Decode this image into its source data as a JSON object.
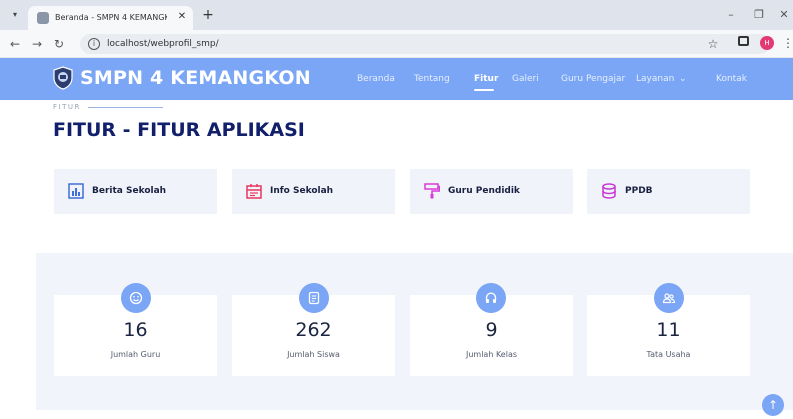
{
  "browser": {
    "tab_title": "Beranda - SMPN 4 KEMANGKO",
    "tab_close": "✕",
    "new_tab": "+",
    "url": "localhost/webprofil_smp/",
    "profile_initial": "H",
    "icons": [
      "tab-menu-icon",
      "favicon-icon",
      "back-icon",
      "forward-icon",
      "reload-icon",
      "info-icon",
      "star-icon",
      "side-panel-icon",
      "profile-icon",
      "kebab-icon",
      "minimize-icon",
      "restore-icon",
      "close-icon"
    ]
  },
  "navbar": {
    "brand": "SMPN 4 KEMANGKON",
    "items": [
      {
        "label": "Beranda",
        "active": false
      },
      {
        "label": "Tentang",
        "active": false
      },
      {
        "label": "Fitur",
        "active": true
      },
      {
        "label": "Galeri",
        "active": false
      },
      {
        "label": "Guru Pengajar",
        "active": false
      },
      {
        "label": "Layanan",
        "active": false
      },
      {
        "label": "Kontak",
        "active": false
      }
    ],
    "dropdown_caret": "⌄",
    "color": "#7aa6f5"
  },
  "section": {
    "eyebrow": "FITUR",
    "title": "FITUR - FITUR APLIKASI"
  },
  "features": [
    {
      "label": "Berita Sekolah",
      "icon": "bar-chart-icon",
      "color": "#3f6fd8"
    },
    {
      "label": "Info Sekolah",
      "icon": "calendar-icon",
      "color": "#e8365f"
    },
    {
      "label": "Guru Pendidik",
      "icon": "paint-roller-icon",
      "color": "#d93bd9"
    },
    {
      "label": "PPDB",
      "icon": "database-icon",
      "color": "#c835d6"
    }
  ],
  "stats": [
    {
      "value": "16",
      "label": "Jumlah Guru",
      "icon": "smile-icon"
    },
    {
      "value": "262",
      "label": "Jumlah Siswa",
      "icon": "document-icon"
    },
    {
      "value": "9",
      "label": "Jumlah Kelas",
      "icon": "headphones-icon"
    },
    {
      "value": "11",
      "label": "Tata Usaha",
      "icon": "people-icon"
    }
  ],
  "back_to_top": "↑"
}
